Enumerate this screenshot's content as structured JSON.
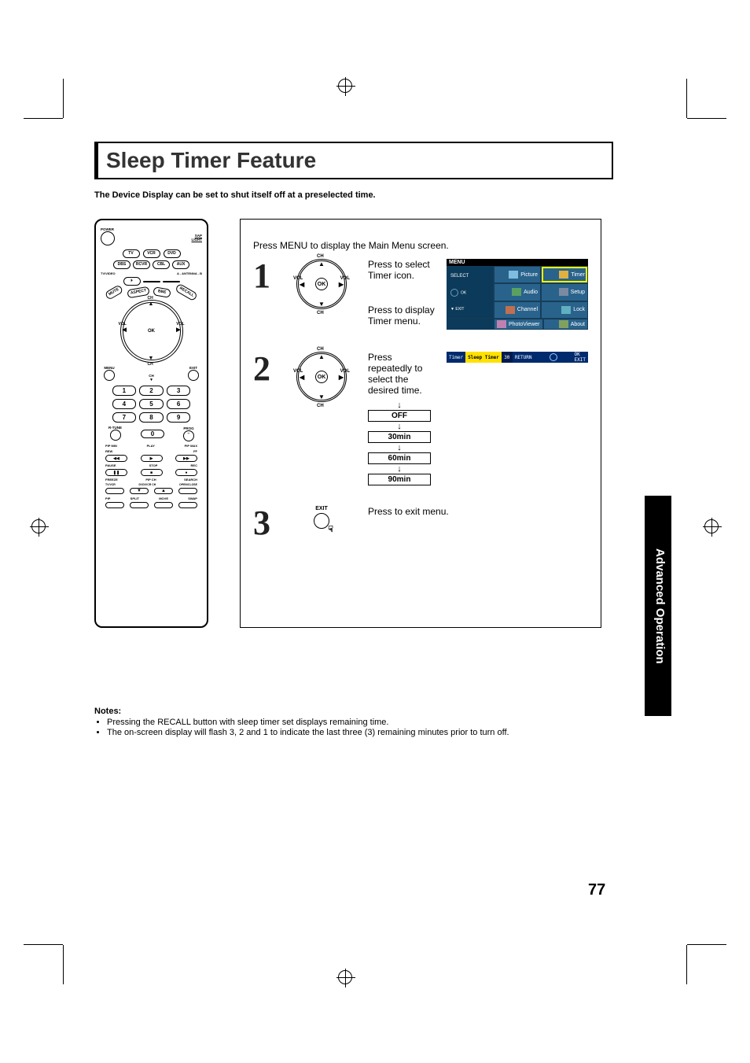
{
  "title": "Sleep Timer Feature",
  "intro": "The Device Display can be set to shut itself off at a preselected time.",
  "pre_step": "Press MENU to display the Main Menu screen.",
  "steps": {
    "s1": {
      "num": "1",
      "a": "Press to select Timer icon.",
      "b": "Press to display Timer menu."
    },
    "s2": {
      "num": "2",
      "a": "Press repeatedly to select  the desired time."
    },
    "s3": {
      "num": "3",
      "a": "Press to exit menu."
    }
  },
  "options": [
    "OFF",
    "30min",
    "60min",
    "90min"
  ],
  "osd": {
    "menu_label": "MENU",
    "select_label": "SELECT",
    "ok_label": "OK",
    "exit_label": "EXIT",
    "cells": [
      "Picture",
      "Timer",
      "Audio",
      "Setup",
      "Channel",
      "Lock",
      "PhotoViewer",
      "About"
    ]
  },
  "osd_bar": {
    "title": "Timer",
    "label": "Sleep Timer",
    "value": "30",
    "return": "RETURN",
    "ok": "OK",
    "exit": "EXIT"
  },
  "dpad": {
    "ok": "OK",
    "ch": "CH",
    "vol": "VOL"
  },
  "exit_label": "EXIT",
  "side_tab": "Advanced Operation",
  "notes": {
    "heading": "Notes:",
    "items": [
      "Pressing the RECALL button with sleep timer set displays remaining time.",
      "The on-screen display will flash 3, 2 and 1 to indicate the last three (3) remaining minutes prior to turn off."
    ]
  },
  "page_number": "77",
  "remote": {
    "power": "POWER",
    "sap": "SAP",
    "light": "LIGHT",
    "row1": [
      "TV",
      "VCR",
      "DVD"
    ],
    "row2": [
      "DBS",
      "RCVR",
      "CBL",
      "AUX"
    ],
    "lab_l": "TV/VIDEO",
    "lab_r": "A - ANTENNA - B",
    "arc": [
      "MUTE",
      "ASPECT",
      "BBE",
      "RECALL"
    ],
    "dpad_ch": "CH",
    "dpad_vol": "VOL",
    "dpad_ok": "OK",
    "menu": "MENU",
    "exit": "EXIT",
    "nums": [
      "1",
      "2",
      "3",
      "4",
      "5",
      "6",
      "7",
      "8",
      "9",
      "0"
    ],
    "rtune": "R-TUNE",
    "prog": "PROG",
    "media_top": [
      "PIP MIN",
      "PLAY",
      "PIP MAX"
    ],
    "media_top2": [
      "REW",
      "",
      "FF"
    ],
    "media_mid": [
      "PAUSE",
      "STOP",
      "REC"
    ],
    "row_bot1": [
      "FREEZE",
      "PIP CH",
      "SEARCH"
    ],
    "row_bot1b": [
      "TV/VCR",
      "DVD/VCR CH",
      "OPEN/CLOSE"
    ],
    "row_bot2": [
      "PIP",
      "SPLIT",
      "MOVE",
      "SWAP"
    ]
  }
}
